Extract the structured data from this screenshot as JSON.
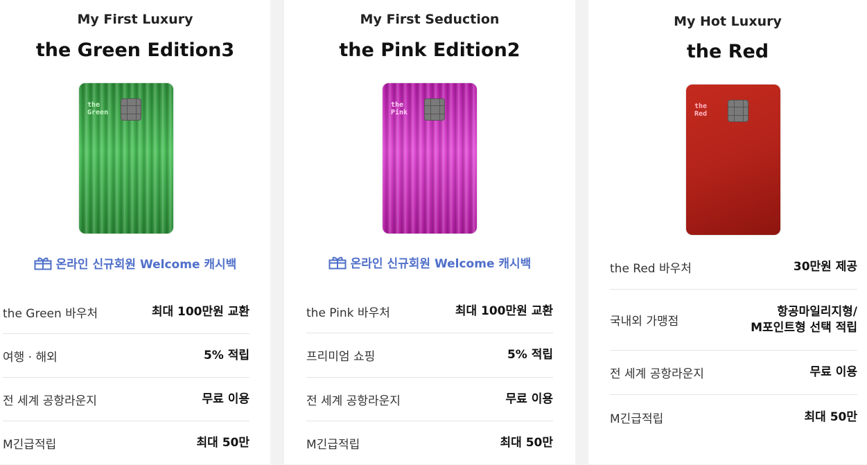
{
  "cards": [
    {
      "subtitle": "My First Luxury",
      "title": "the Green Edition3",
      "card_print": "the\nGreen",
      "promo": "온라인 신규회원 Welcome 캐시백",
      "benefits": [
        {
          "label": "the Green 바우처",
          "value": "최대 100만원 교환"
        },
        {
          "label": "여행 · 해외",
          "value": "5% 적립"
        },
        {
          "label": "전 세계 공항라운지",
          "value": "무료 이용"
        },
        {
          "label": "M긴급적립",
          "value": "최대 50만"
        }
      ]
    },
    {
      "subtitle": "My First Seduction",
      "title": "the Pink Edition2",
      "card_print": "the\nPink",
      "promo": "온라인 신규회원 Welcome 캐시백",
      "benefits": [
        {
          "label": "the Pink 바우처",
          "value": "최대 100만원 교환"
        },
        {
          "label": "프리미엄 쇼핑",
          "value": "5% 적립"
        },
        {
          "label": "전 세계 공항라운지",
          "value": "무료 이용"
        },
        {
          "label": "M긴급적립",
          "value": "최대 50만"
        }
      ]
    },
    {
      "subtitle": "My Hot Luxury",
      "title": "the Red",
      "card_print": "the\nRed",
      "benefits": [
        {
          "label": "the Red 바우처",
          "value": "30만원 제공"
        },
        {
          "label": "국내외 가맹점",
          "value": "항공마일리지형/\nM포인트형 선택 적립"
        },
        {
          "label": "전 세계 공항라운지",
          "value": "무료 이용"
        },
        {
          "label": "M긴급적립",
          "value": "최대 50만"
        }
      ]
    }
  ],
  "colors": {
    "promo": "#4f6fc9",
    "background": "#f2f2f2",
    "panel": "#ffffff"
  },
  "icons": {
    "promo": "gift-icon"
  }
}
